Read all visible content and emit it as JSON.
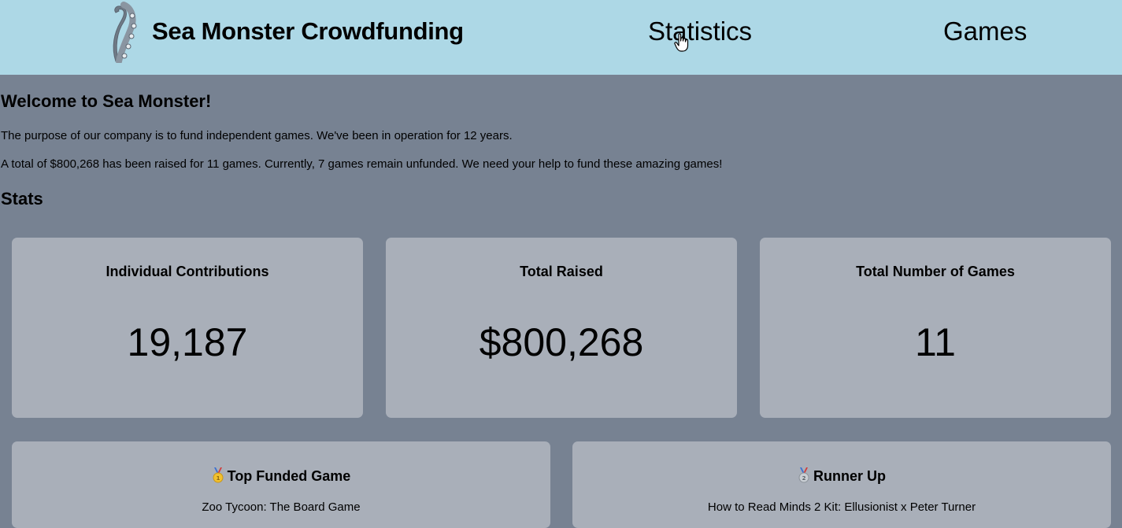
{
  "header": {
    "brand": "Sea Monster Crowdfunding",
    "logo_icon": "tentacle-icon",
    "nav": [
      {
        "label": "Statistics"
      },
      {
        "label": "Games"
      }
    ],
    "background": "#add8e6"
  },
  "intro": {
    "heading": "Welcome to Sea Monster!",
    "paragraph1": "The purpose of our company is to fund independent games. We've been in operation for 12 years.",
    "paragraph2": "A total of $800,268 has been raised for 11 games. Currently, 7 games remain unfunded. We need your help to fund these amazing games!"
  },
  "stats": {
    "heading": "Stats",
    "cards": [
      {
        "title": "Individual Contributions",
        "value": "19,187"
      },
      {
        "title": "Total Raised",
        "value": "$800,268"
      },
      {
        "title": "Total Number of Games",
        "value": "11"
      }
    ]
  },
  "featured": {
    "top": {
      "icon": "gold-medal-icon",
      "title": "Top Funded Game",
      "game": "Zoo Tycoon: The Board Game"
    },
    "runner_up": {
      "icon": "silver-medal-icon",
      "title": "Runner Up",
      "game": "How to Read Minds 2 Kit: Ellusionist x Peter Turner"
    }
  },
  "colors": {
    "page_background": "#778292",
    "card_background": "#a9afb9"
  }
}
